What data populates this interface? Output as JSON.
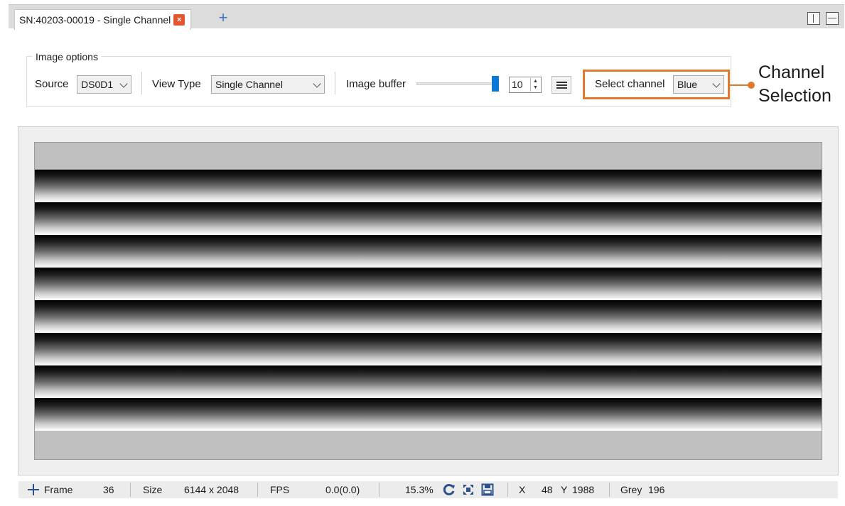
{
  "tab": {
    "title": "SN:40203-00019 - Single Channel",
    "close_symbol": "×",
    "add_symbol": "+"
  },
  "options": {
    "legend": "Image options",
    "source_label": "Source",
    "source_value": "DS0D1",
    "view_type_label": "View Type",
    "view_type_value": "Single Channel",
    "buffer_label": "Image buffer",
    "buffer_level": 1.0,
    "buffer_value": "10",
    "select_channel_label": "Select channel",
    "select_channel_value": "Blue"
  },
  "callout": {
    "line1": "Channel",
    "line2": "Selection",
    "color": "#e0782d"
  },
  "status": {
    "frame_label": "Frame",
    "frame_value": "36",
    "size_label": "Size",
    "size_value": "6144 x 2048",
    "fps_label": "FPS",
    "fps_value": "0.0(0.0)",
    "zoom_value": "15.3%",
    "x_label": "X",
    "x_value": "48",
    "y_label": "Y",
    "y_value": "1988",
    "grey_label": "Grey",
    "grey_value": "196"
  },
  "colors": {
    "accent": "#0a78d7",
    "close": "#e2572f",
    "highlight": "#e0782d"
  }
}
